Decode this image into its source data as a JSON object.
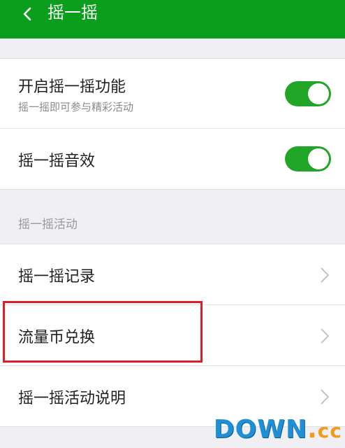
{
  "header": {
    "title": "摇一摇"
  },
  "settings": {
    "shake_enable": {
      "title": "开启摇一摇功能",
      "subtitle": "摇一摇即可参与精彩活动",
      "toggle_on": true
    },
    "shake_sound": {
      "title": "摇一摇音效",
      "toggle_on": true
    }
  },
  "activities": {
    "section_label": "摇一摇活动",
    "items": [
      {
        "label": "摇一摇记录"
      },
      {
        "label": "流量币兑换"
      },
      {
        "label": "摇一摇活动说明"
      }
    ]
  },
  "watermark": {
    "main": "DOWN",
    "dot": ".",
    "cc": "cc"
  },
  "colors": {
    "header_bg": "#0a9e1c",
    "toggle_on": "#21a526",
    "highlight": "#d9202a"
  }
}
